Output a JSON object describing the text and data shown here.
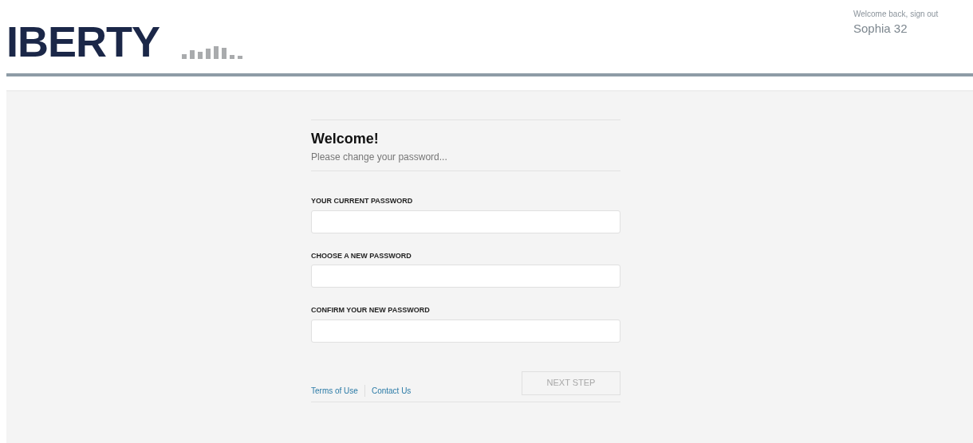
{
  "header": {
    "logo_text": "IBERTY",
    "greeting": "Welcome back,",
    "sign_out": "sign out",
    "user_name": "Sophia 32"
  },
  "form": {
    "title": "Welcome!",
    "subtitle": "Please change your password...",
    "fields": [
      {
        "label": "YOUR CURRENT PASSWORD"
      },
      {
        "label": "CHOOSE A NEW PASSWORD"
      },
      {
        "label": "CONFIRM YOUR NEW PASSWORD"
      }
    ],
    "links": [
      "Terms of Use",
      "Contact Us"
    ],
    "next_button": {
      "label": "NEXT STEP",
      "disabled": true
    }
  }
}
